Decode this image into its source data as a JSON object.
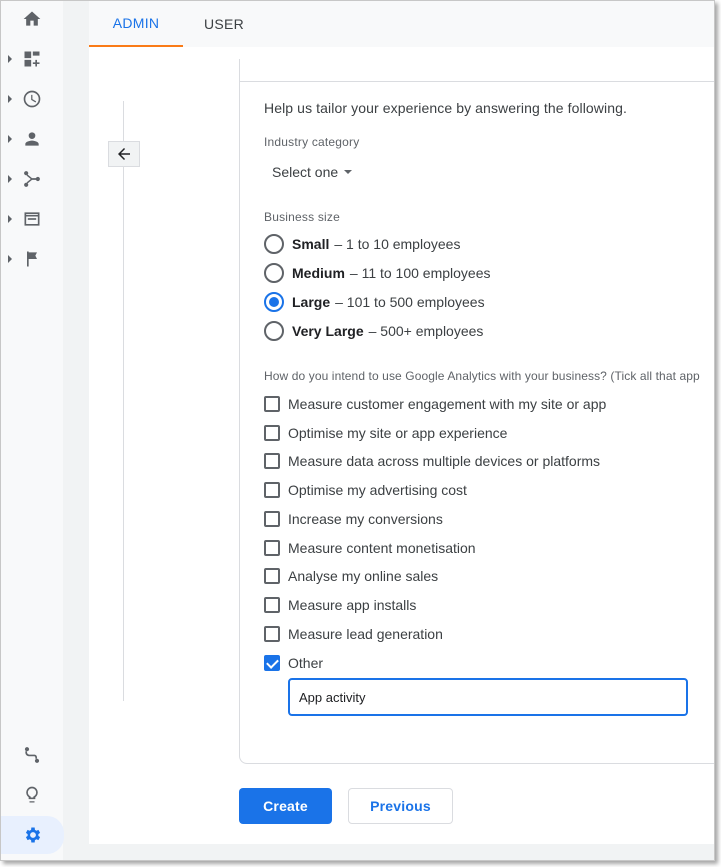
{
  "tabs": {
    "admin": "ADMIN",
    "user": "USER"
  },
  "form": {
    "intro": "Help us tailor your experience by answering the following.",
    "industry_label": "Industry category",
    "industry_value": "Select one",
    "size_label": "Business size",
    "sizes": [
      {
        "name": "Small",
        "desc": "– 1 to 10 employees",
        "checked": false
      },
      {
        "name": "Medium",
        "desc": "– 11 to 100 employees",
        "checked": false
      },
      {
        "name": "Large",
        "desc": "– 101 to 500 employees",
        "checked": true
      },
      {
        "name": "Very Large",
        "desc": "– 500+ employees",
        "checked": false
      }
    ],
    "use_label": "How do you intend to use Google Analytics with your business? (Tick all that app",
    "uses": [
      {
        "label": "Measure customer engagement with my site or app",
        "checked": false
      },
      {
        "label": "Optimise my site or app experience",
        "checked": false
      },
      {
        "label": "Measure data across multiple devices or platforms",
        "checked": false
      },
      {
        "label": "Optimise my advertising cost",
        "checked": false
      },
      {
        "label": "Increase my conversions",
        "checked": false
      },
      {
        "label": "Measure content monetisation",
        "checked": false
      },
      {
        "label": "Analyse my online sales",
        "checked": false
      },
      {
        "label": "Measure app installs",
        "checked": false
      },
      {
        "label": "Measure lead generation",
        "checked": false
      },
      {
        "label": "Other",
        "checked": true
      }
    ],
    "other_value": "App activity"
  },
  "buttons": {
    "create": "Create",
    "previous": "Previous"
  },
  "colors": {
    "accent": "#1a73e8",
    "tab_indicator": "#fa7b17"
  }
}
